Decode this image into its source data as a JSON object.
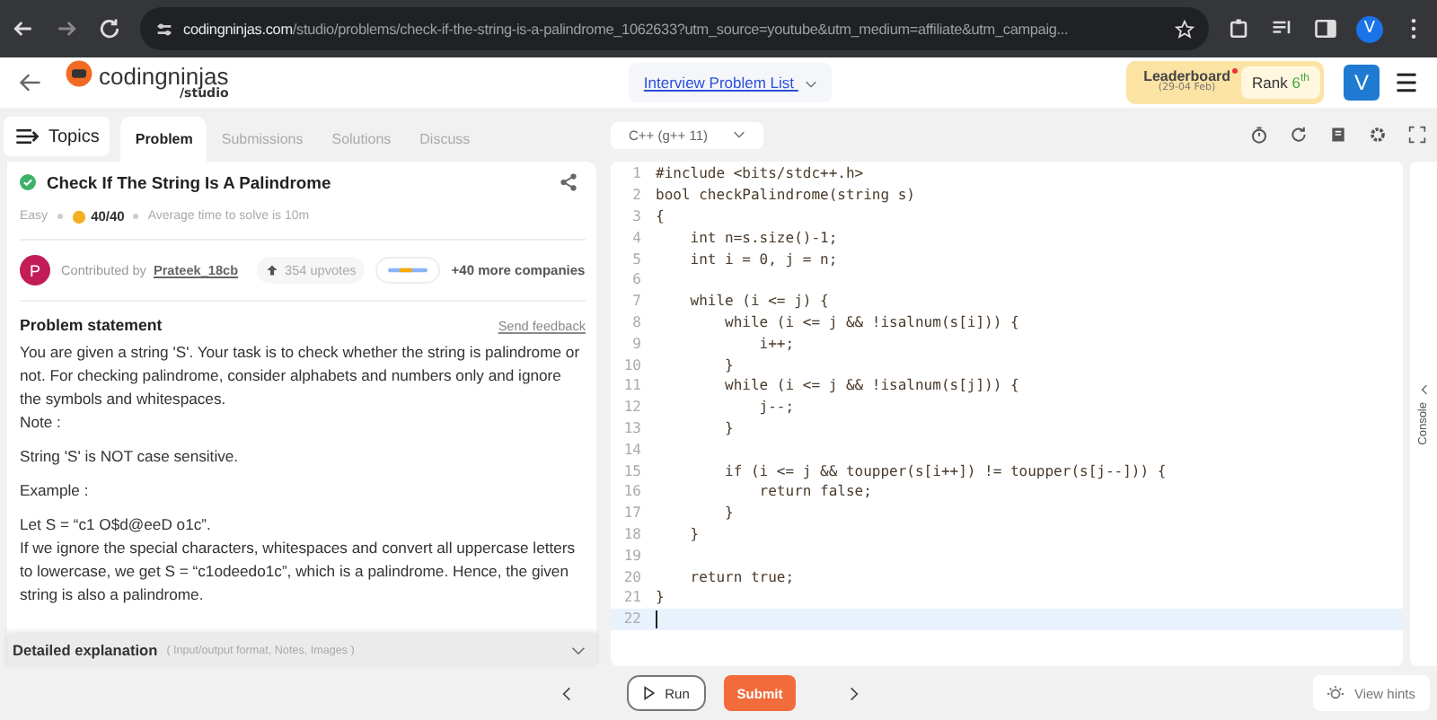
{
  "browser": {
    "url_domain": "codingninjas.com",
    "url_path": "/studio/problems/check-if-the-string-is-a-palindrome_1062633?utm_source=youtube&utm_medium=affiliate&utm_campaig...",
    "profile_letter": "V"
  },
  "header": {
    "logo_name": "codingninjas",
    "logo_sub": "/studio",
    "problem_list": "Interview Problem List",
    "leaderboard": "Leaderboard",
    "leaderboard_dates": "(29-04 Feb)",
    "rank_label": "Rank",
    "rank_value": "6$^{th}$",
    "avatar_letter": "V"
  },
  "tabs": [
    {
      "label": "Problem",
      "selected": true
    },
    {
      "label": "Submissions",
      "selected": false
    },
    {
      "label": "Solutions",
      "selected": false
    },
    {
      "label": "Discuss",
      "selected": false
    }
  ],
  "topics": "Topics",
  "problem": {
    "title": "Check If The String Is A Palindrome",
    "solved": true,
    "difficulty": "Easy",
    "score": "40/40",
    "avg_time": "Average time to solve is 10m",
    "contributor_initial": "P",
    "contributed_by": "Contributed by",
    "contributor": "Prateek_18cb",
    "upvotes": "354 upvotes",
    "companies": "+40 more companies",
    "statement_title": "Problem statement",
    "feedback": "Send feedback",
    "paragraphs": [
      "You are given a string 'S'. Your task is to check whether the string is palindrome or not. For checking palindrome, consider alphabets and numbers only and ignore the symbols and whitespaces.\nNote :",
      "String 'S' is NOT case sensitive.",
      "Example :",
      "Let S = “c1 O$d@eeD o1c”.\nIf we ignore the special characters, whitespaces and convert all uppercase letters to lowercase, we get S = “c1odeedo1c”, which is a palindrome. Hence, the given string is also a palindrome."
    ],
    "detailed": "Detailed explanation",
    "detailed_hint": "( Input/output format, Notes, Images )"
  },
  "editor": {
    "language": "C++ (g++ 11)",
    "console": "Console",
    "lines": [
      {
        "number": "1",
        "code": "#include <bits/stdc++.h>",
        "current": false
      },
      {
        "number": "2",
        "code": "bool checkPalindrome(string s)",
        "current": false
      },
      {
        "number": "3",
        "code": "{",
        "current": false
      },
      {
        "number": "4",
        "code": "    int n=s.size()-1;",
        "current": false
      },
      {
        "number": "5",
        "code": "    int i = 0, j = n;",
        "current": false
      },
      {
        "number": "6",
        "current": false
      },
      {
        "number": "7",
        "code": "    while (i <= j) {",
        "current": false
      },
      {
        "number": "8",
        "code": "        while (i <= j && !isalnum(s[i])) {",
        "current": false
      },
      {
        "number": "9",
        "code": "            i++;",
        "current": false
      },
      {
        "number": "10",
        "code": "        }",
        "current": false
      },
      {
        "number": "11",
        "code": "        while (i <= j && !isalnum(s[j])) {",
        "current": false
      },
      {
        "number": "12",
        "code": "            j--;",
        "current": false
      },
      {
        "number": "13",
        "code": "        }",
        "current": false
      },
      {
        "number": "14",
        "current": false
      },
      {
        "number": "15",
        "code": "        if (i <= j && toupper(s[i++]) != toupper(s[j--])) {",
        "current": false
      },
      {
        "number": "16",
        "code": "            return false;",
        "current": false
      },
      {
        "number": "17",
        "code": "        }",
        "current": false
      },
      {
        "number": "18",
        "code": "    }",
        "current": false
      },
      {
        "number": "19",
        "current": false
      },
      {
        "number": "20",
        "code": "    return true;",
        "current": false
      },
      {
        "number": "21",
        "code": "}",
        "current": false
      },
      {
        "number": "22",
        "current": true
      }
    ]
  },
  "footer": {
    "run": "Run",
    "submit": "Submit",
    "hints": "View hints"
  }
}
